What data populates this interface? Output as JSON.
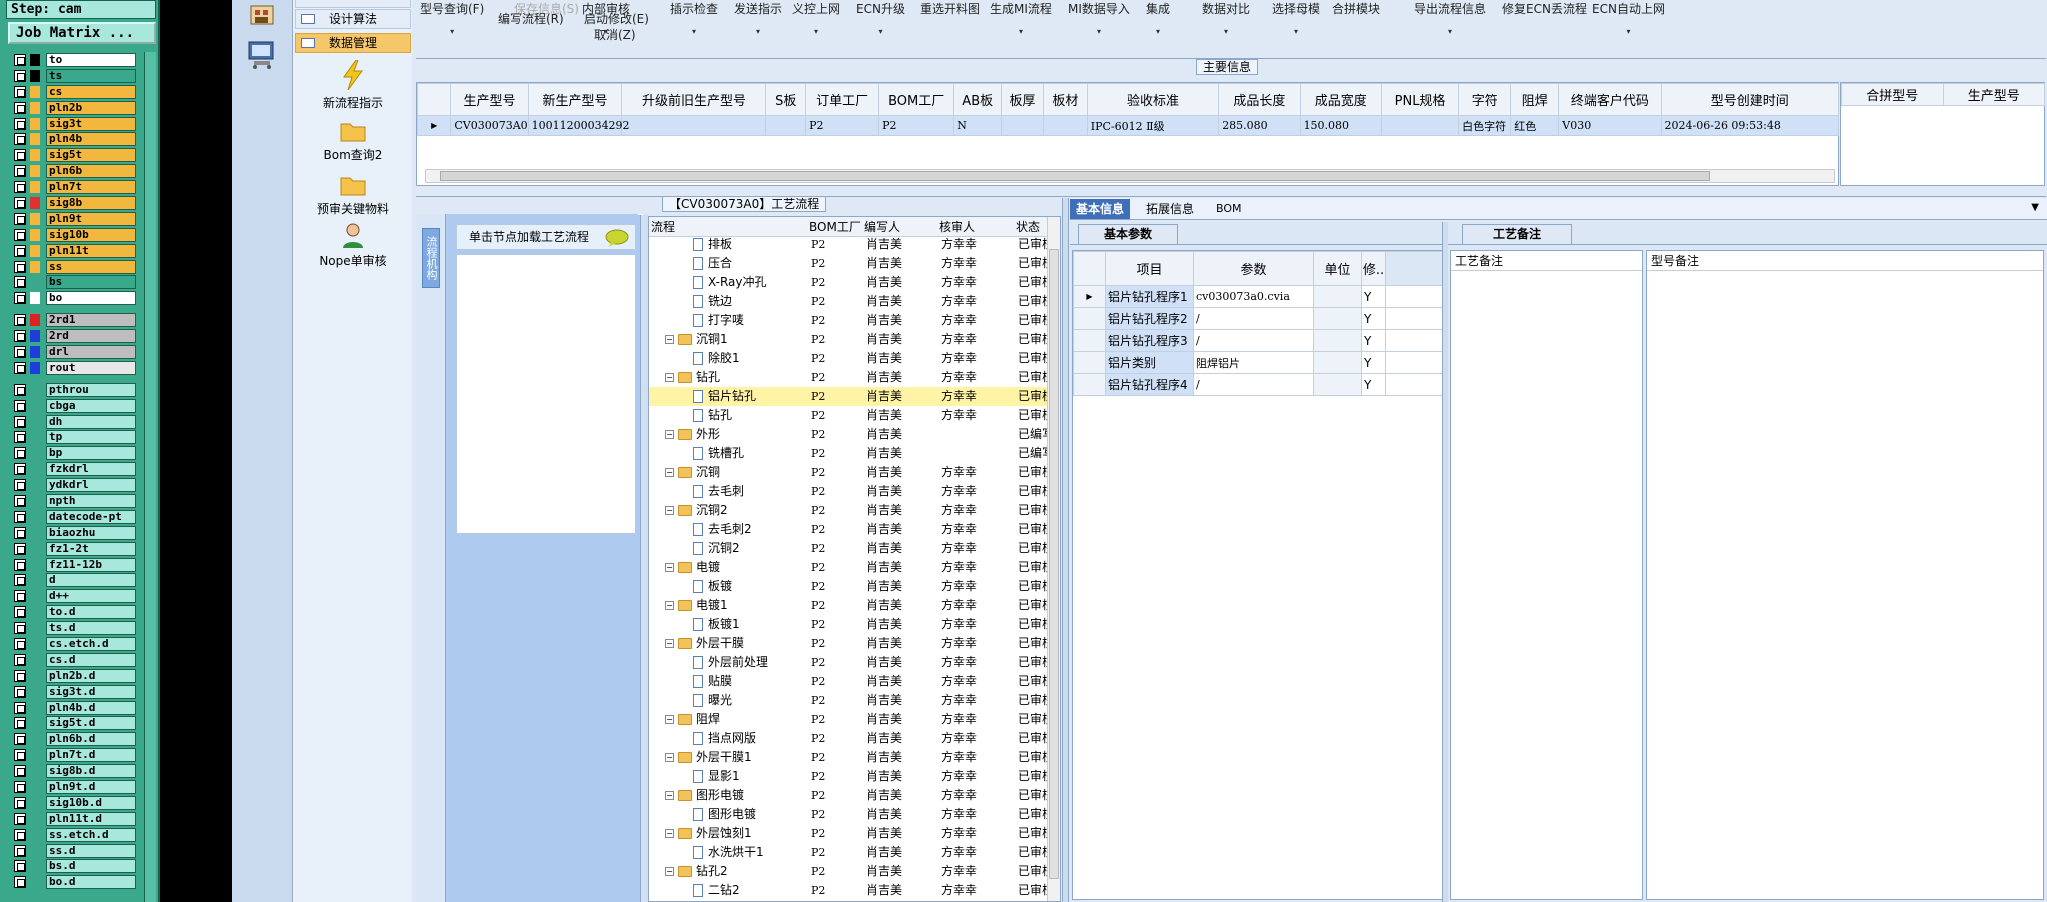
{
  "cam": {
    "step": "Step: cam",
    "job_matrix": "Job Matrix ...",
    "layers_a": [
      {
        "name": "to",
        "bg": "#ffffff",
        "sw": "#000000"
      },
      {
        "name": "ts",
        "bg": "#3aa88a",
        "sw": "#000000"
      },
      {
        "name": "cs",
        "bg": "#f3b73e",
        "sw": "#f3b73e"
      },
      {
        "name": "pln2b",
        "bg": "#f3b73e",
        "sw": "#f3b73e"
      },
      {
        "name": "sig3t",
        "bg": "#f3b73e",
        "sw": "#f3b73e"
      },
      {
        "name": "pln4b",
        "bg": "#f3b73e",
        "sw": "#f3b73e"
      },
      {
        "name": "sig5t",
        "bg": "#f3b73e",
        "sw": "#f3b73e"
      },
      {
        "name": "pln6b",
        "bg": "#f3b73e",
        "sw": "#f3b73e"
      },
      {
        "name": "pln7t",
        "bg": "#f3b73e",
        "sw": "#f3b73e"
      },
      {
        "name": "sig8b",
        "bg": "#f3b73e",
        "sw": "#e03030"
      },
      {
        "name": "pln9t",
        "bg": "#f3b73e",
        "sw": "#f3b73e"
      },
      {
        "name": "sig10b",
        "bg": "#f3b73e",
        "sw": "#f3b73e"
      },
      {
        "name": "pln11t",
        "bg": "#f3b73e",
        "sw": "#f3b73e"
      },
      {
        "name": "ss",
        "bg": "#f3b73e",
        "sw": "#f3b73e"
      },
      {
        "name": "bs",
        "bg": "#3aa88a",
        "sw": "#3aa88a"
      },
      {
        "name": "bo",
        "bg": "#ffffff",
        "sw": "#ffffff"
      }
    ],
    "layers_b": [
      {
        "name": "2rd1",
        "bg": "#bdbdbd",
        "sw": "#e02020"
      },
      {
        "name": "2rd",
        "bg": "#bdbdbd",
        "sw": "#1c3fd8"
      },
      {
        "name": "drl",
        "bg": "#bdbdbd",
        "sw": "#1c3fd8"
      },
      {
        "name": "rout",
        "bg": "#e8e8e8",
        "sw": "#1c3fd8"
      }
    ],
    "layers_c": [
      "pthrou",
      "cbga",
      "dh",
      "tp",
      "bp",
      "fzkdrl",
      "ydkdrl",
      "npth",
      "datecode-pt",
      "biaozhu",
      "fz1-2t",
      "fz11-12b",
      "d",
      "d++",
      "to.d",
      "ts.d",
      "cs.etch.d",
      "cs.d",
      "pln2b.d",
      "sig3t.d",
      "pln4b.d",
      "sig5t.d",
      "pln6b.d",
      "pln7t.d",
      "sig8b.d",
      "pln9t.d",
      "sig10b.d",
      "pln11t.d",
      "ss.etch.d",
      "ss.d",
      "bs.d",
      "bo.d"
    ]
  },
  "nav": {
    "btn_design": "设计算法",
    "btn_data": "数据管理",
    "items": [
      {
        "label": "新流程指示",
        "icon": "lightning-icon"
      },
      {
        "label": "Bom查询2",
        "icon": "folder-icon"
      },
      {
        "label": "预审关键物料",
        "icon": "folder-icon"
      },
      {
        "label": "Nope单审核",
        "icon": "user-icon"
      }
    ]
  },
  "toolbar": {
    "items": [
      "型号查询(F)",
      "保存信息(S)",
      "内部审核",
      "插示检查",
      "发送指示",
      "义控上网",
      "ECN升级",
      "重选开料图",
      "生成MI流程",
      "MI数据导入",
      "集成",
      "数据对比",
      "选择母模",
      "合拼模块",
      "导出流程信息",
      "修复ECN丢流程",
      "ECN自动上网"
    ],
    "sub1": "编写流程(R)",
    "sub2": "启动修改(E)",
    "sub3": "取消(Z)"
  },
  "main_info": {
    "title": "主要信息",
    "headers": [
      "生产型号",
      "新生产型号",
      "升级前旧生产型号",
      "S板",
      "订单工厂",
      "BOM工厂",
      "AB板",
      "板厚",
      "板材",
      "验收标准",
      "成品长度",
      "成品宽度",
      "PNL规格",
      "字符",
      "阻焊",
      "终端客户代码",
      "型号创建时间"
    ],
    "row": [
      "CV030073A0",
      "10011200034292",
      "",
      "",
      "P2",
      "P2",
      "N",
      "",
      "",
      "IPC-6012 Ⅱ级",
      "285.080",
      "150.080",
      "",
      "白色字符",
      "红色",
      "V030",
      "2024-06-26 09:53:48"
    ],
    "side_headers": [
      "合拼型号",
      "生产型号"
    ]
  },
  "process": {
    "title": "【CV030073A0】工艺流程",
    "side_tab": "流程机构",
    "load_btn": "单击节点加载工艺流程",
    "headers": [
      "流程",
      "BOM工厂",
      "编写人",
      "核审人",
      "状态"
    ],
    "rows": [
      {
        "level": 2,
        "type": "doc",
        "name": "排板",
        "f": "P2",
        "w": "肖吉美",
        "r": "方幸幸",
        "s": "已审核"
      },
      {
        "level": 2,
        "type": "doc",
        "name": "压合",
        "f": "P2",
        "w": "肖吉美",
        "r": "方幸幸",
        "s": "已审核"
      },
      {
        "level": 2,
        "type": "doc",
        "name": "X-Ray冲孔",
        "f": "P2",
        "w": "肖吉美",
        "r": "方幸幸",
        "s": "已审核"
      },
      {
        "level": 2,
        "type": "doc",
        "name": "铣边",
        "f": "P2",
        "w": "肖吉美",
        "r": "方幸幸",
        "s": "已审核"
      },
      {
        "level": 2,
        "type": "doc",
        "name": "打字唛",
        "f": "P2",
        "w": "肖吉美",
        "r": "方幸幸",
        "s": "已审核"
      },
      {
        "level": 1,
        "type": "folder",
        "name": "沉铜1",
        "f": "P2",
        "w": "肖吉美",
        "r": "方幸幸",
        "s": "已审核"
      },
      {
        "level": 2,
        "type": "doc",
        "name": "除胶1",
        "f": "P2",
        "w": "肖吉美",
        "r": "方幸幸",
        "s": "已审核"
      },
      {
        "level": 1,
        "type": "folder",
        "name": "钻孔",
        "f": "P2",
        "w": "肖吉美",
        "r": "方幸幸",
        "s": "已审核"
      },
      {
        "level": 2,
        "type": "doc",
        "name": "铝片钻孔",
        "f": "P2",
        "w": "肖吉美",
        "r": "方幸幸",
        "s": "已审核",
        "sel": true
      },
      {
        "level": 2,
        "type": "doc",
        "name": "钻孔",
        "f": "P2",
        "w": "肖吉美",
        "r": "方幸幸",
        "s": "已审核"
      },
      {
        "level": 1,
        "type": "folder",
        "name": "外形",
        "f": "P2",
        "w": "肖吉美",
        "r": "",
        "s": "已编写"
      },
      {
        "level": 2,
        "type": "doc",
        "name": "铣槽孔",
        "f": "P2",
        "w": "肖吉美",
        "r": "",
        "s": "已编写"
      },
      {
        "level": 1,
        "type": "folder",
        "name": "沉铜",
        "f": "P2",
        "w": "肖吉美",
        "r": "方幸幸",
        "s": "已审核"
      },
      {
        "level": 2,
        "type": "doc",
        "name": "去毛刺",
        "f": "P2",
        "w": "肖吉美",
        "r": "方幸幸",
        "s": "已审核"
      },
      {
        "level": 1,
        "type": "folder",
        "name": "沉铜2",
        "f": "P2",
        "w": "肖吉美",
        "r": "方幸幸",
        "s": "已审核"
      },
      {
        "level": 2,
        "type": "doc",
        "name": "去毛刺2",
        "f": "P2",
        "w": "肖吉美",
        "r": "方幸幸",
        "s": "已审核"
      },
      {
        "level": 2,
        "type": "doc",
        "name": "沉铜2",
        "f": "P2",
        "w": "肖吉美",
        "r": "方幸幸",
        "s": "已审核"
      },
      {
        "level": 1,
        "type": "folder",
        "name": "电镀",
        "f": "P2",
        "w": "肖吉美",
        "r": "方幸幸",
        "s": "已审核"
      },
      {
        "level": 2,
        "type": "doc",
        "name": "板镀",
        "f": "P2",
        "w": "肖吉美",
        "r": "方幸幸",
        "s": "已审核"
      },
      {
        "level": 1,
        "type": "folder",
        "name": "电镀1",
        "f": "P2",
        "w": "肖吉美",
        "r": "方幸幸",
        "s": "已审核"
      },
      {
        "level": 2,
        "type": "doc",
        "name": "板镀1",
        "f": "P2",
        "w": "肖吉美",
        "r": "方幸幸",
        "s": "已审核"
      },
      {
        "level": 1,
        "type": "folder",
        "name": "外层干膜",
        "f": "P2",
        "w": "肖吉美",
        "r": "方幸幸",
        "s": "已审核"
      },
      {
        "level": 2,
        "type": "doc",
        "name": "外层前处理",
        "f": "P2",
        "w": "肖吉美",
        "r": "方幸幸",
        "s": "已审核"
      },
      {
        "level": 2,
        "type": "doc",
        "name": "贴膜",
        "f": "P2",
        "w": "肖吉美",
        "r": "方幸幸",
        "s": "已审核"
      },
      {
        "level": 2,
        "type": "doc",
        "name": "曝光",
        "f": "P2",
        "w": "肖吉美",
        "r": "方幸幸",
        "s": "已审核"
      },
      {
        "level": 1,
        "type": "folder",
        "name": "阻焊",
        "f": "P2",
        "w": "肖吉美",
        "r": "方幸幸",
        "s": "已审核"
      },
      {
        "level": 2,
        "type": "doc",
        "name": "挡点网版",
        "f": "P2",
        "w": "肖吉美",
        "r": "方幸幸",
        "s": "已审核"
      },
      {
        "level": 1,
        "type": "folder",
        "name": "外层干膜1",
        "f": "P2",
        "w": "肖吉美",
        "r": "方幸幸",
        "s": "已审核"
      },
      {
        "level": 2,
        "type": "doc",
        "name": "显影1",
        "f": "P2",
        "w": "肖吉美",
        "r": "方幸幸",
        "s": "已审核"
      },
      {
        "level": 1,
        "type": "folder",
        "name": "图形电镀",
        "f": "P2",
        "w": "肖吉美",
        "r": "方幸幸",
        "s": "已审核"
      },
      {
        "level": 2,
        "type": "doc",
        "name": "图形电镀",
        "f": "P2",
        "w": "肖吉美",
        "r": "方幸幸",
        "s": "已审核"
      },
      {
        "level": 1,
        "type": "folder",
        "name": "外层蚀刻1",
        "f": "P2",
        "w": "肖吉美",
        "r": "方幸幸",
        "s": "已审核"
      },
      {
        "level": 2,
        "type": "doc",
        "name": "水洗烘干1",
        "f": "P2",
        "w": "肖吉美",
        "r": "方幸幸",
        "s": "已审核"
      },
      {
        "level": 1,
        "type": "folder",
        "name": "钻孔2",
        "f": "P2",
        "w": "肖吉美",
        "r": "方幸幸",
        "s": "已审核"
      },
      {
        "level": 2,
        "type": "doc",
        "name": "二钻2",
        "f": "P2",
        "w": "肖吉美",
        "r": "方幸幸",
        "s": "已审核"
      }
    ]
  },
  "basic": {
    "tabs": [
      "基本信息",
      "拓展信息",
      "BOM"
    ],
    "sub_tab": "基本参数",
    "headers": [
      "项目",
      "参数",
      "单位",
      "修.."
    ],
    "rows": [
      {
        "item": "铝片钻孔程序1",
        "param": "cv030073a0.cvia",
        "unit": "",
        "mod": "Y"
      },
      {
        "item": "铝片钻孔程序2",
        "param": "/",
        "unit": "",
        "mod": "Y"
      },
      {
        "item": "铝片钻孔程序3",
        "param": "/",
        "unit": "",
        "mod": "Y"
      },
      {
        "item": "铝片类别",
        "param": "阻焊铝片",
        "unit": "",
        "mod": "Y"
      },
      {
        "item": "铝片钻孔程序4",
        "param": "/",
        "unit": "",
        "mod": "Y"
      }
    ]
  },
  "remark": {
    "tab": "工艺备注",
    "col1": "工艺备注",
    "col2": "型号备注"
  }
}
